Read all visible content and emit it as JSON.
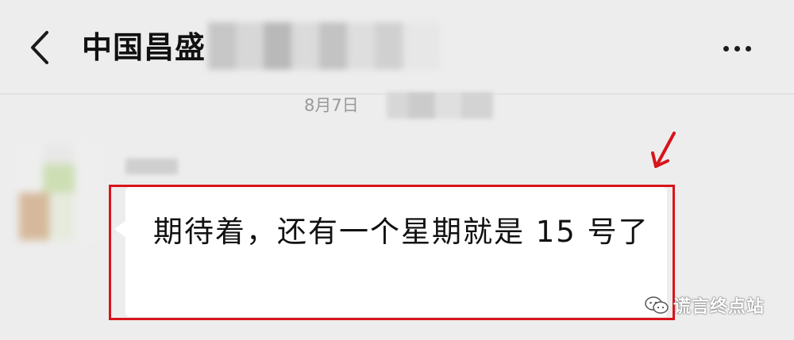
{
  "header": {
    "title": "中国昌盛"
  },
  "conversation": {
    "timestamp": "8月7日"
  },
  "message": {
    "text": "期待着，还有一个星期就是 15 号了"
  },
  "watermark": {
    "text": "谎言终点站"
  },
  "colors": {
    "background": "#ededed",
    "bubble": "#ffffff",
    "highlight": "#d8141c"
  },
  "icons": {
    "back": "chevron-left-icon",
    "more": "more-dots-icon",
    "annotation_arrow": "red-arrow-icon",
    "watermark": "wechat-icon"
  }
}
